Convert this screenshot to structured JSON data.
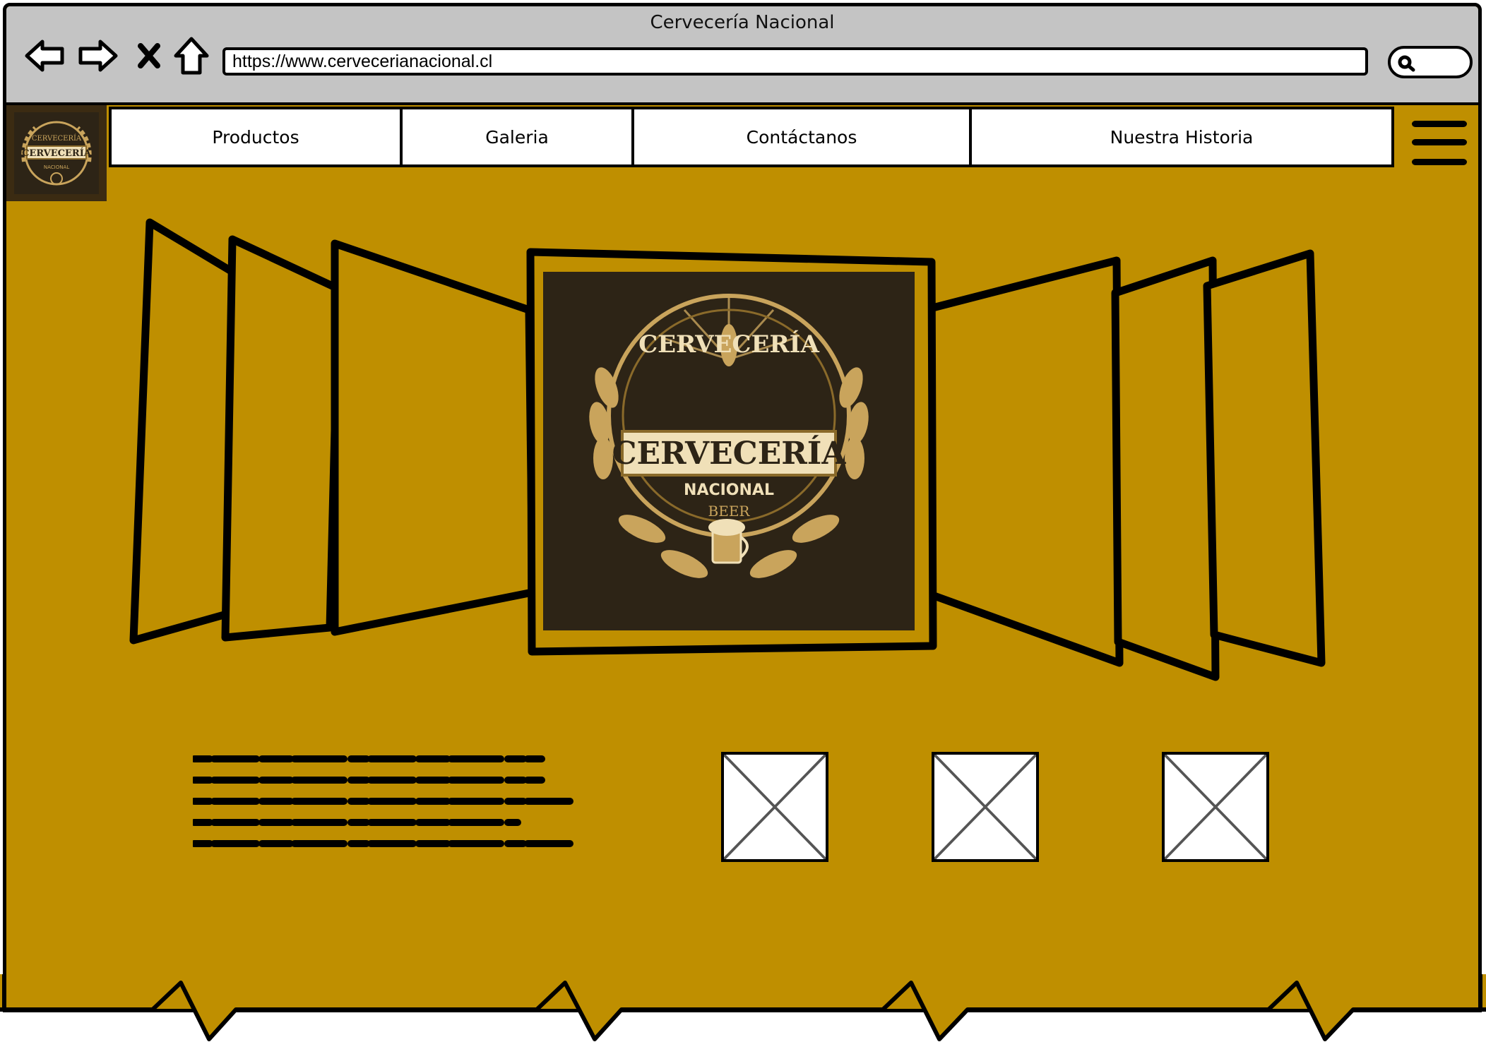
{
  "browser": {
    "window_title": "Cervecería Nacional",
    "url": "https://www.cervecerianacional.cl",
    "buttons": {
      "back": "back-arrow-icon",
      "forward": "forward-arrow-icon",
      "close": "close-icon",
      "home": "home-icon",
      "search": "search-icon"
    }
  },
  "nav": {
    "items": [
      {
        "label": "Productos"
      },
      {
        "label": "Galeria"
      },
      {
        "label": "Contáctanos"
      },
      {
        "label": "Nuestra Historia"
      }
    ],
    "menu_icon": "hamburger-menu-icon"
  },
  "logo": {
    "line1": "CERVECERÍA",
    "line2": "CERVECERÍA",
    "line3": "NACIONAL",
    "line4": "BEER"
  },
  "colors": {
    "page_bg": "#bf8f00",
    "chrome_bg": "#c4c4c4",
    "logo_bg": "#2d2416",
    "logo_gold": "#c9a45c"
  },
  "gallery": {
    "image_placeholders": 3
  }
}
